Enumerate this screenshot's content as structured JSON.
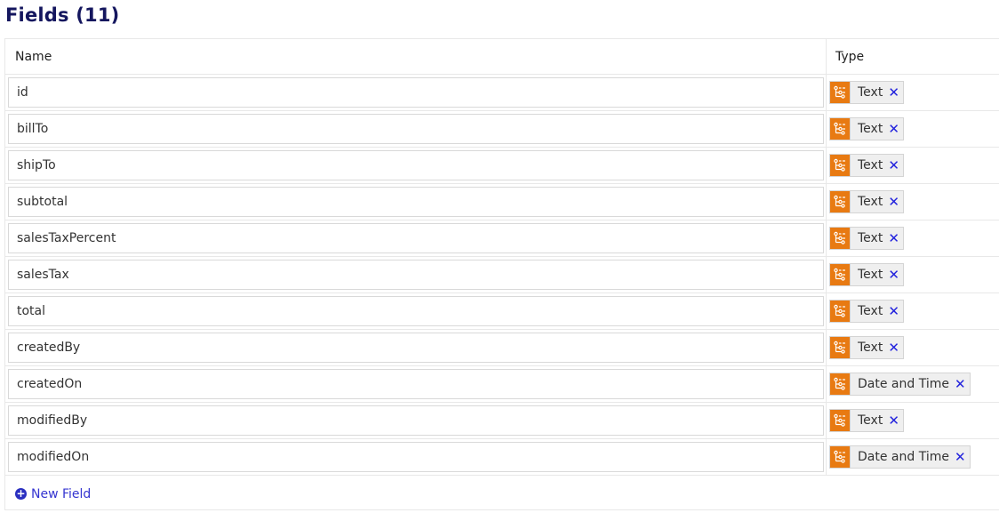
{
  "title": "Fields (11)",
  "columns": {
    "name": "Name",
    "type": "Type"
  },
  "fields": [
    {
      "name": "id",
      "type": "Text",
      "type_icon": "data-type-icon"
    },
    {
      "name": "billTo",
      "type": "Text",
      "type_icon": "data-type-icon"
    },
    {
      "name": "shipTo",
      "type": "Text",
      "type_icon": "data-type-icon"
    },
    {
      "name": "subtotal",
      "type": "Text",
      "type_icon": "data-type-icon"
    },
    {
      "name": "salesTaxPercent",
      "type": "Text",
      "type_icon": "data-type-icon"
    },
    {
      "name": "salesTax",
      "type": "Text",
      "type_icon": "data-type-icon"
    },
    {
      "name": "total",
      "type": "Text",
      "type_icon": "data-type-icon"
    },
    {
      "name": "createdBy",
      "type": "Text",
      "type_icon": "data-type-icon"
    },
    {
      "name": "createdOn",
      "type": "Date and Time",
      "type_icon": "data-type-icon"
    },
    {
      "name": "modifiedBy",
      "type": "Text",
      "type_icon": "data-type-icon"
    },
    {
      "name": "modifiedOn",
      "type": "Date and Time",
      "type_icon": "data-type-icon"
    }
  ],
  "remove_symbol": "✕",
  "new_field": {
    "label": "New Field",
    "icon": "plus-circle-icon",
    "icon_glyph": "+"
  },
  "colors": {
    "title": "#14165e",
    "type_icon_bg": "#e87a12",
    "remove": "#2222dd",
    "link": "#3535d0"
  }
}
